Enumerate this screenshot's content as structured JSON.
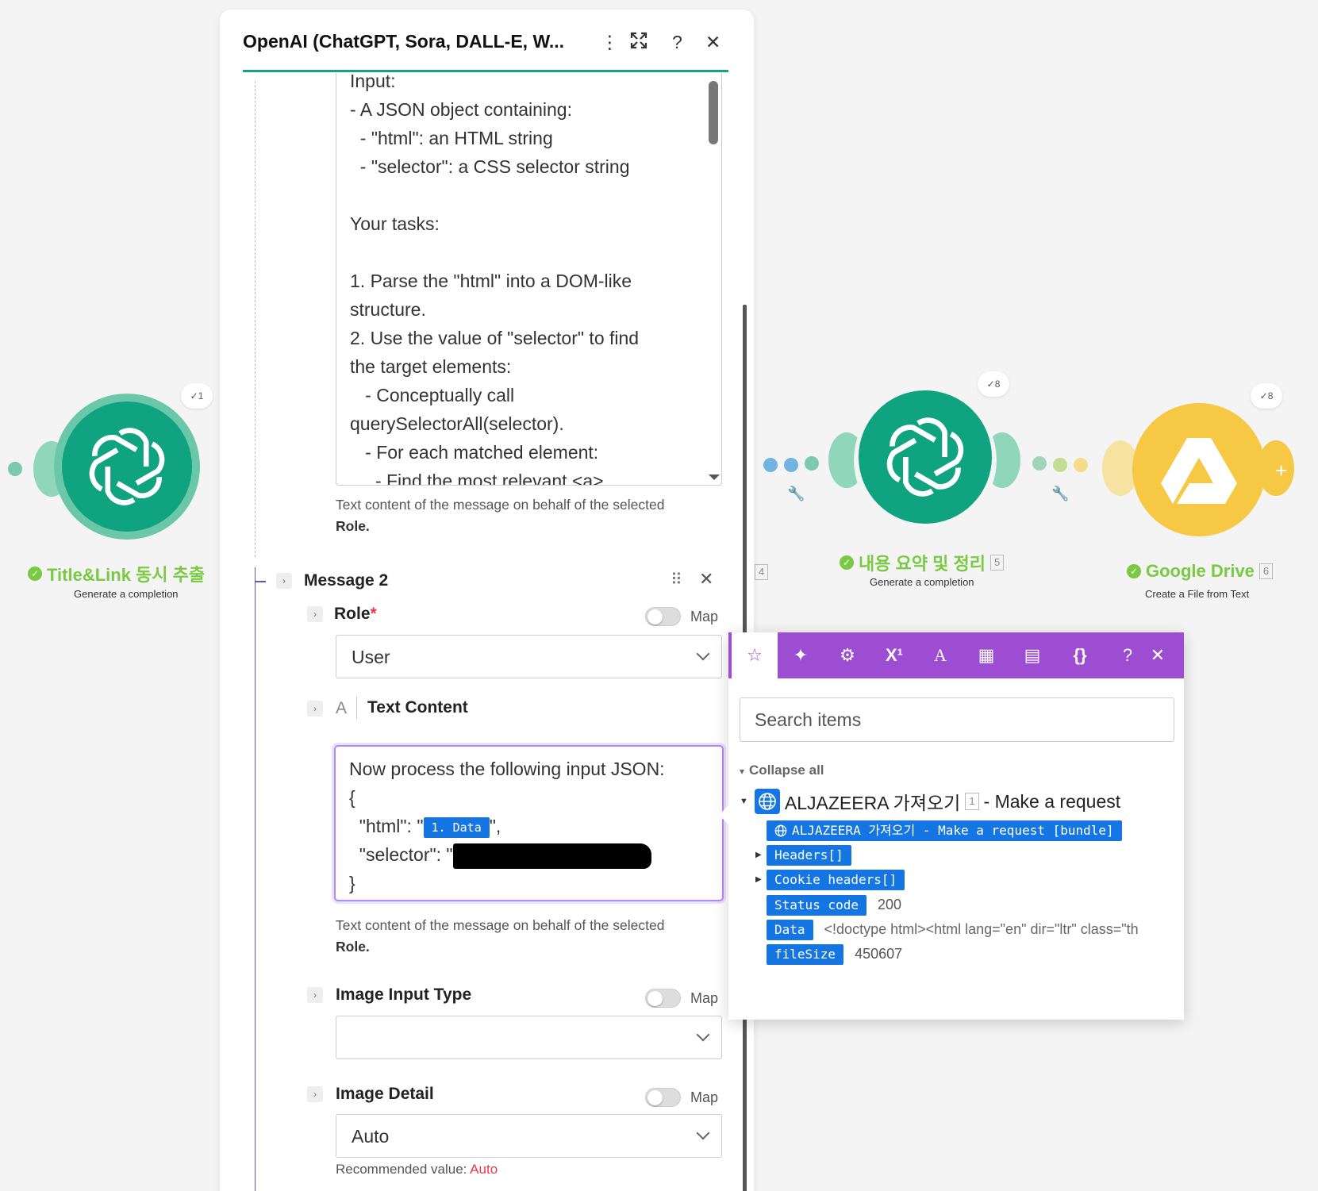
{
  "panel": {
    "title": "OpenAI (ChatGPT, Sora, DALL-E, W...",
    "header_icons": [
      "more-vertical-icon",
      "expand-icon",
      "help-icon",
      "close-icon"
    ],
    "message1": {
      "text_lines": [
        "Input:",
        "- A JSON object containing:",
        "  - \"html\": an HTML string",
        "  - \"selector\": a CSS selector string",
        "",
        "Your tasks:",
        "",
        "1. Parse the \"html\" into a DOM-like",
        "structure.",
        "2. Use the value of \"selector\" to find",
        "the target elements:",
        "   - Conceptually call",
        "querySelectorAll(selector).",
        "   - For each matched element:",
        "     - Find the most relevant <a>"
      ],
      "help_text": "Text content of the message on behalf of the selected",
      "help_bold": "Role."
    },
    "message2": {
      "title": "Message 2",
      "role_label": "Role",
      "required_mark": "*",
      "map_label": "Map",
      "role_value": "User",
      "text_content_label": "Text Content",
      "text_type_icon": "A",
      "content_line1": "Now process the following input JSON:",
      "content_line2": "{",
      "content_html_prefix": "  \"html\": \"",
      "content_html_pill": "1. Data",
      "content_html_suffix": "\",",
      "content_selector_prefix": "  \"selector\": \"",
      "content_line5": "}",
      "help_text": "Text content of the message on behalf of the selected",
      "help_bold": "Role.",
      "image_input_type_label": "Image Input Type",
      "image_input_type_value": "",
      "image_detail_label": "Image Detail",
      "image_detail_value": "Auto",
      "recommended_label": "Recommended value:",
      "recommended_value": "Auto"
    }
  },
  "canvas": {
    "nodes": [
      {
        "name": "Title&Link 동시 추출",
        "subtitle": "Generate a completion",
        "badge": "1",
        "number": "",
        "color": "#10a37f",
        "halo": "#6ac8a8"
      },
      {
        "name": "내용 요약 및 정리",
        "subtitle": "Generate a completion",
        "badge": "8",
        "number": "5",
        "color": "#10a37f",
        "halo": "#7cd0b2"
      },
      {
        "name": "Google Drive",
        "subtitle": "Create a File from Text",
        "badge": "8",
        "number": "6",
        "color": "#f7c844",
        "halo": "#f3dc8a"
      }
    ],
    "hidden_number": "4",
    "title_green": "#7ac943"
  },
  "mapper": {
    "toolbar_icons": [
      "star-icon",
      "sparkle-icon",
      "gear-icon",
      "superscript-icon",
      "text-icon",
      "calendar-icon",
      "table-icon",
      "braces-icon",
      "help-icon",
      "close-icon"
    ],
    "toolbar_glyphs": [
      "☆",
      "✦",
      "⚙",
      "X¹",
      "A",
      "▦",
      "▤",
      "{}",
      "?",
      "✕"
    ],
    "search_placeholder": "Search items",
    "collapse_all": "Collapse all",
    "module_name": "ALJAZEERA 가져오기",
    "module_number": "1",
    "module_action": "- Make a request",
    "bundle_label": "ALJAZEERA 가져오기 - Make a request [bundle]",
    "items": [
      {
        "key": "Headers[]",
        "value": "",
        "expandable": true
      },
      {
        "key": "Cookie headers[]",
        "value": "",
        "expandable": true
      },
      {
        "key": "Status code",
        "value": "200",
        "expandable": false
      },
      {
        "key": "Data",
        "value": "<!doctype html><html lang=\"en\" dir=\"ltr\" class=\"th",
        "expandable": false
      },
      {
        "key": "fileSize",
        "value": "450607",
        "expandable": false
      }
    ],
    "accent": "#9d4dd1",
    "pill_color": "#1576e3"
  }
}
